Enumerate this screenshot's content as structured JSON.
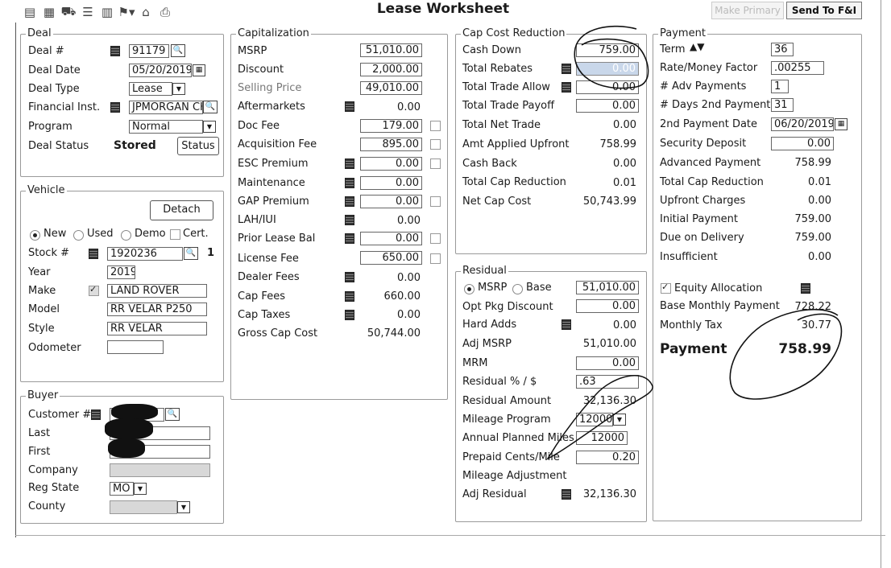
{
  "app": {
    "title": "Lease Worksheet"
  },
  "toolbar": {
    "icons": [
      "document-icon",
      "calculator-icon",
      "car-icon",
      "list-icon",
      "calendar-icon",
      "flag-icon",
      "home-icon",
      "printer-icon"
    ],
    "make_primary_label": "Make Primary",
    "send_fi_label": "Send To F&I"
  },
  "deal": {
    "legend": "Deal",
    "deal_no_label": "Deal #",
    "deal_no": "91179",
    "deal_date_label": "Deal Date",
    "deal_date": "05/20/2019",
    "deal_type_label": "Deal Type",
    "deal_type": "Lease",
    "fin_inst_label": "Financial Inst.",
    "fin_inst": "JPMORGAN CHA",
    "program_label": "Program",
    "program": "Normal",
    "status_label": "Deal Status",
    "status": "Stored",
    "status_button": "Status"
  },
  "vehicle": {
    "legend": "Vehicle",
    "detach_label": "Detach",
    "cond_new": "New",
    "cond_used": "Used",
    "cond_demo": "Demo",
    "cond_cert": "Cert.",
    "stock_label": "Stock #",
    "stock": "1920236",
    "stock_count": "1",
    "year_label": "Year",
    "year": "2019",
    "make_label": "Make",
    "make": "LAND ROVER",
    "model_label": "Model",
    "model": "RR VELAR P250",
    "style_label": "Style",
    "style": "RR VELAR",
    "odometer_label": "Odometer",
    "odometer": ""
  },
  "buyer": {
    "legend": "Buyer",
    "customer_label": "Customer #",
    "last_label": "Last",
    "first_label": "First",
    "company_label": "Company",
    "reg_state_label": "Reg State",
    "reg_state": "MO",
    "county_label": "County"
  },
  "cap": {
    "legend": "Capitalization",
    "msrp_label": "MSRP",
    "msrp": "51,010.00",
    "discount_label": "Discount",
    "discount": "2,000.00",
    "selling_label": "Selling Price",
    "selling": "49,010.00",
    "aftermarkets_label": "Aftermarkets",
    "aftermarkets": "0.00",
    "doc_fee_label": "Doc Fee",
    "doc_fee": "179.00",
    "acq_fee_label": "Acquisition Fee",
    "acq_fee": "895.00",
    "esc_label": "ESC Premium",
    "esc": "0.00",
    "maint_label": "Maintenance",
    "maint": "0.00",
    "gap_label": "GAP Premium",
    "gap": "0.00",
    "lah_label": "LAH/IUI",
    "lah": "0.00",
    "prior_label": "Prior Lease Bal",
    "prior": "0.00",
    "license_label": "License Fee",
    "license": "650.00",
    "dealer_fees_label": "Dealer Fees",
    "dealer_fees": "0.00",
    "cap_fees_label": "Cap Fees",
    "cap_fees": "660.00",
    "cap_taxes_label": "Cap Taxes",
    "cap_taxes": "0.00",
    "gross_label": "Gross Cap Cost",
    "gross": "50,744.00"
  },
  "ccr": {
    "legend": "Cap Cost Reduction",
    "cash_down_label": "Cash Down",
    "cash_down": "759.00",
    "rebates_label": "Total Rebates",
    "rebates": "0.00",
    "trade_allow_label": "Total Trade Allow",
    "trade_allow": "0.00",
    "trade_payoff_label": "Total Trade Payoff",
    "trade_payoff": "0.00",
    "net_trade_label": "Total Net Trade",
    "net_trade": "0.00",
    "applied_label": "Amt Applied Upfront",
    "applied": "758.99",
    "cash_back_label": "Cash Back",
    "cash_back": "0.00",
    "total_ccr_label": "Total Cap Reduction",
    "total_ccr": "0.01",
    "net_cap_label": "Net Cap Cost",
    "net_cap": "50,743.99"
  },
  "residual": {
    "legend": "Residual",
    "msrp_opt": "MSRP",
    "base_opt": "Base",
    "base_value": "51,010.00",
    "opt_pkg_label": "Opt Pkg Discount",
    "opt_pkg": "0.00",
    "hard_adds_label": "Hard Adds",
    "hard_adds": "0.00",
    "adj_msrp_label": "Adj MSRP",
    "adj_msrp": "51,010.00",
    "mrm_label": "MRM",
    "mrm": "0.00",
    "pct_label": "Residual % / $",
    "pct": ".63",
    "amount_label": "Residual Amount",
    "amount": "32,136.30",
    "mileage_prog_label": "Mileage Program",
    "mileage_prog": "12000",
    "annual_label": "Annual Planned Miles",
    "annual": "12000",
    "prepaid_label": "Prepaid Cents/Mile",
    "prepaid": "0.20",
    "mileage_adj_label": "Mileage Adjustment",
    "adj_residual_label": "Adj Residual",
    "adj_residual": "32,136.30"
  },
  "payment": {
    "legend": "Payment",
    "term_label": "Term",
    "term": "36",
    "rate_label": "Rate/Money Factor",
    "rate": ".00255",
    "adv_label": "# Adv Payments",
    "adv": "1",
    "days_label": "# Days 2nd Payment",
    "days": "31",
    "second_date_label": "2nd Payment Date",
    "second_date": "06/20/2019",
    "security_label": "Security Deposit",
    "security": "0.00",
    "advanced_label": "Advanced Payment",
    "advanced": "758.99",
    "total_ccr_label": "Total Cap Reduction",
    "total_ccr": "0.01",
    "upfront_label": "Upfront Charges",
    "upfront": "0.00",
    "initial_label": "Initial Payment",
    "initial": "759.00",
    "due_label": "Due on Delivery",
    "due": "759.00",
    "insufficient_label": "Insufficient",
    "insufficient": "0.00",
    "equity_label": "Equity Allocation",
    "base_monthly_label": "Base Monthly Payment",
    "base_monthly": "728.22",
    "monthly_tax_label": "Monthly Tax",
    "monthly_tax": "30.77",
    "payment_label": "Payment",
    "payment": "758.99"
  }
}
